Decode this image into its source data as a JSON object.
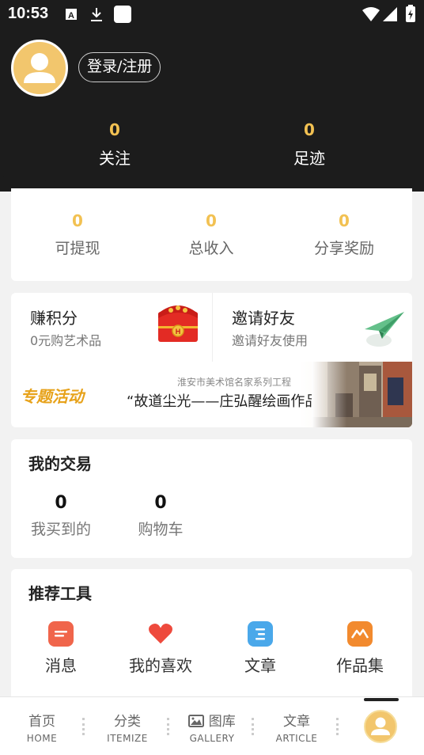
{
  "status_bar": {
    "time": "10:53"
  },
  "header": {
    "login_label": "登录/注册",
    "stats": [
      {
        "value": "0",
        "label": "关注"
      },
      {
        "value": "0",
        "label": "足迹"
      }
    ]
  },
  "earnings": [
    {
      "value": "0",
      "label": "可提现"
    },
    {
      "value": "0",
      "label": "总收入"
    },
    {
      "value": "0",
      "label": "分享奖励"
    }
  ],
  "promos": [
    {
      "title": "赚积分",
      "subtitle": "0元购艺术品"
    },
    {
      "title": "邀请好友",
      "subtitle": "邀请好友使用"
    }
  ],
  "banner": {
    "tag": "专题活动",
    "subtitle": "淮安市美术馆名家系列工程",
    "title": "“故道尘光——庄弘醒绘画作品展”"
  },
  "trade": {
    "title": "我的交易",
    "items": [
      {
        "value": "0",
        "label": "我买到的"
      },
      {
        "value": "0",
        "label": "购物车"
      }
    ]
  },
  "tools": {
    "title": "推荐工具",
    "items": [
      {
        "label": "消息",
        "icon": "message-icon",
        "color": "#f0654b"
      },
      {
        "label": "我的喜欢",
        "icon": "heart-icon",
        "color": "#ee4a3d"
      },
      {
        "label": "文章",
        "icon": "article-icon",
        "color": "#4aa8ea"
      },
      {
        "label": "作品集",
        "icon": "portfolio-icon",
        "color": "#f28a2e"
      }
    ]
  },
  "bottom_nav": [
    {
      "label": "首页",
      "en": "HOME"
    },
    {
      "label": "分类",
      "en": "ITEMIZE"
    },
    {
      "label": "图库",
      "en": "GALLERY"
    },
    {
      "label": "文章",
      "en": "ARTICLE"
    }
  ],
  "colors": {
    "accent": "#f2c152",
    "header_bg": "#1c1c1c"
  }
}
